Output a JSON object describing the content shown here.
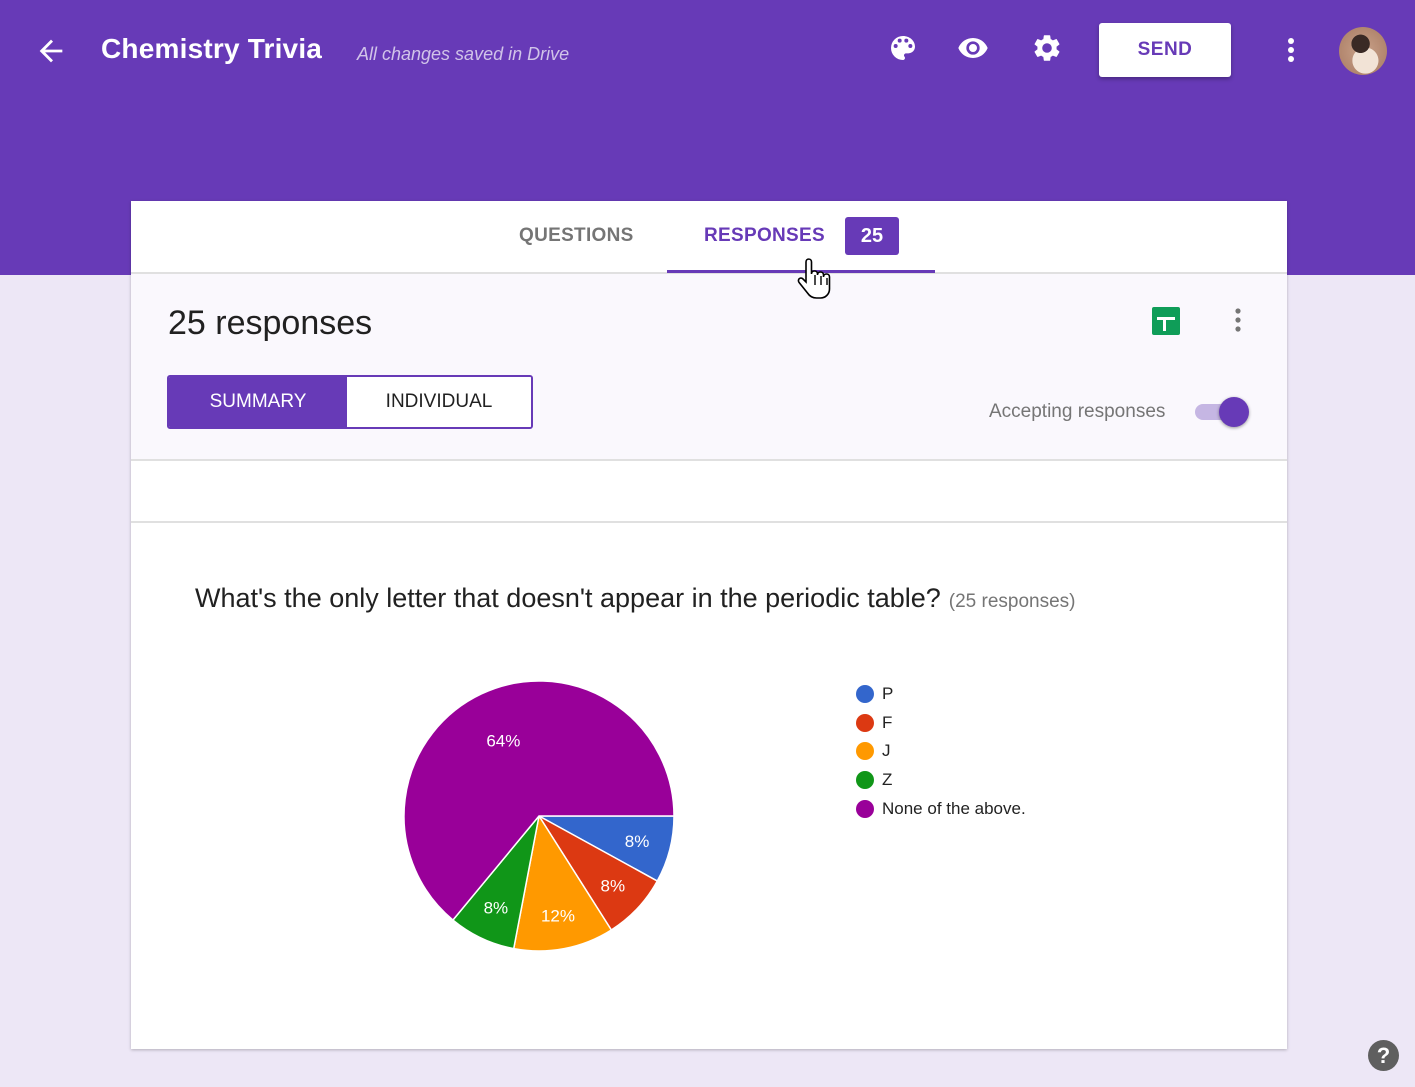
{
  "header": {
    "title": "Chemistry Trivia",
    "save_status": "All changes saved in Drive",
    "send_label": "SEND",
    "icons": [
      "back-arrow-icon",
      "palette-icon",
      "eye-icon",
      "gear-icon",
      "more-vert-icon",
      "avatar"
    ]
  },
  "tabs": {
    "questions_label": "QUESTIONS",
    "responses_label": "RESPONSES",
    "responses_badge": "25",
    "active": "RESPONSES"
  },
  "summary": {
    "count_label": "25 responses",
    "view_summary_label": "SUMMARY",
    "view_individual_label": "INDIVIDUAL",
    "active_view": "SUMMARY",
    "accepting_label": "Accepting responses",
    "accepting_on": true
  },
  "question": {
    "text": "What's the only letter that doesn't appear in the periodic table?",
    "count_label": "(25 responses)"
  },
  "help_label": "?",
  "colors": {
    "accent": "#673ab7",
    "background": "#ede7f6",
    "sheets_green": "#0f9d58"
  },
  "chart_data": {
    "type": "pie",
    "title": "What's the only letter that doesn't appear in the periodic table?",
    "legend_position": "right",
    "categories": [
      "P",
      "F",
      "J",
      "Z",
      "None of the above."
    ],
    "values": [
      8,
      8,
      12,
      8,
      64
    ],
    "counts": [
      2,
      2,
      3,
      2,
      16
    ],
    "labels": [
      "8%",
      "8%",
      "12%",
      "8%",
      "64%"
    ],
    "colors": [
      "#3366cc",
      "#dc3912",
      "#ff9900",
      "#109618",
      "#990099"
    ]
  }
}
